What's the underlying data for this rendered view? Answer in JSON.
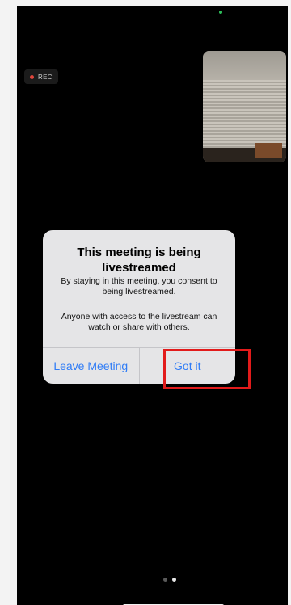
{
  "recording": {
    "label": "REC",
    "dot_color": "#e0463c"
  },
  "dialog": {
    "title": "This meeting is being livestreamed",
    "message_primary": "By staying in this meeting, you consent to being livestreamed.",
    "message_secondary": "Anyone with access to the livestream can watch or share with others.",
    "leave_label": "Leave Meeting",
    "confirm_label": "Got it",
    "action_color": "#2f7cf6"
  },
  "pager": {
    "count": 2,
    "active_index": 1
  },
  "annotation": {
    "highlight_color": "#e21b1b"
  }
}
